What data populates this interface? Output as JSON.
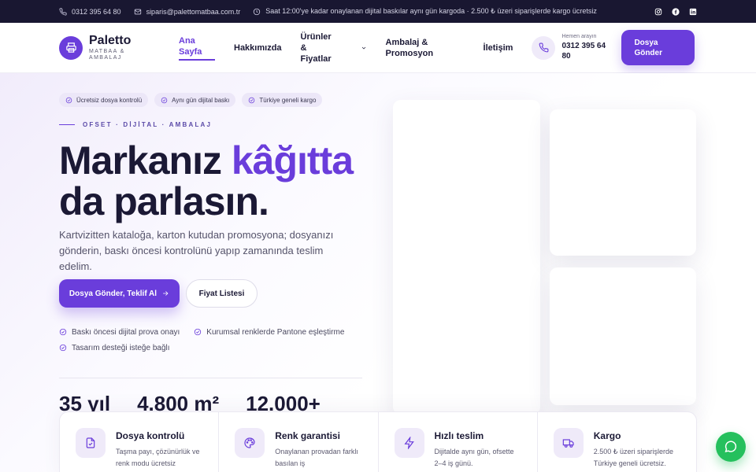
{
  "topbar": {
    "phone": "0312 395 64 80",
    "email": "siparis@palettomatbaa.com.tr",
    "notice": "Saat 12:00'ye kadar onaylanan dijital baskılar aynı gün kargoda · 2.500 ₺ üzeri siparişlerde kargo ücretsiz",
    "social": [
      "instagram-icon",
      "facebook-icon",
      "linkedin-icon"
    ]
  },
  "header": {
    "brand": "Paletto",
    "brand_sub": "MATBAA & AMBALAJ",
    "nav": {
      "home": "Ana Sayfa",
      "about": "Hakkımızda",
      "products": "Ürünler & Fiyatlar",
      "packaging": "Ambalaj & Promosyon",
      "contact": "İletişim"
    },
    "call_label": "Hemen arayın",
    "call_number": "0312 395 64 80",
    "cta": "Dosya Gönder"
  },
  "hero": {
    "badges": [
      "Ücretsiz dosya kontrolü",
      "Aynı gün dijital baskı",
      "Türkiye geneli kargo"
    ],
    "eyebrow": "OFSET · DİJİTAL · AMBALAJ",
    "headline_part1": "Markanız",
    "headline_accent": "kâğıtta",
    "headline_part2": "da parlasın.",
    "lede": "Kartvizitten kataloğa, karton kutudan promosyona; dosyanızı gönderin, baskı öncesi kontrolünü yapıp zamanında teslim edelim.",
    "primary_button": "Dosya Gönder, Teklif Al",
    "secondary_button": "Fiyat Listesi",
    "features": [
      "Baskı öncesi dijital prova onayı",
      "Kurumsal renklerde Pantone eşleştirme",
      "Tasarım desteği isteğe bağlı"
    ],
    "stats": [
      "35 yıl",
      "4.800 m²",
      "12.000+"
    ]
  },
  "services": [
    {
      "title": "Dosya kontrolü",
      "text": "Taşma payı, çözünürlük ve renk modu ücretsiz",
      "icon": "file-check-icon"
    },
    {
      "title": "Renk garantisi",
      "text": "Onaylanan provadan farklı basılan iş",
      "icon": "palette-icon"
    },
    {
      "title": "Hızlı teslim",
      "text": "Dijitalde aynı gün, ofsette 2–4 iş günü.",
      "icon": "bolt-icon"
    },
    {
      "title": "Kargo",
      "text": "2.500 ₺ üzeri siparişlerde Türkiye geneli ücretsiz.",
      "icon": "truck-icon"
    }
  ],
  "colors": {
    "accent": "#6a3ddb",
    "topbar": "#191731",
    "whatsapp": "#25c05d"
  }
}
